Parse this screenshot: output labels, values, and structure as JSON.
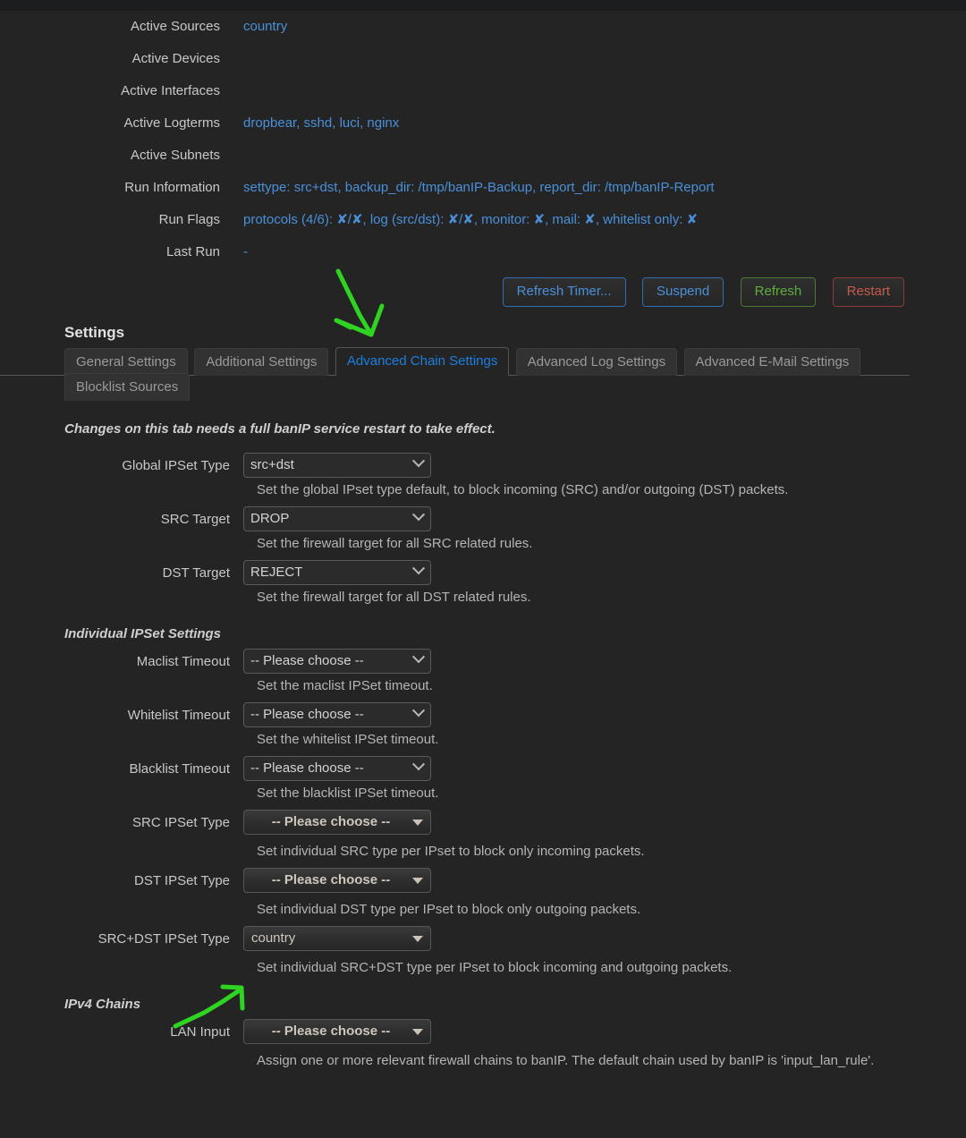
{
  "status": {
    "rows": [
      {
        "label": "Active Sources",
        "value": "country"
      },
      {
        "label": "Active Devices",
        "value": ""
      },
      {
        "label": "Active Interfaces",
        "value": ""
      },
      {
        "label": "Active Logterms",
        "value": "dropbear, sshd, luci, nginx"
      },
      {
        "label": "Active Subnets",
        "value": ""
      },
      {
        "label": "Run Information",
        "value": "settype: src+dst, backup_dir: /tmp/banIP-Backup, report_dir: /tmp/banIP-Report"
      },
      {
        "label": "Run Flags",
        "value": "protocols (4/6): ✘/✘, log (src/dst): ✘/✘, monitor: ✘, mail: ✘, whitelist only: ✘"
      },
      {
        "label": "Last Run",
        "value": "-"
      }
    ]
  },
  "actions": {
    "refresh_timer": "Refresh Timer...",
    "suspend": "Suspend",
    "refresh": "Refresh",
    "restart": "Restart"
  },
  "settings": {
    "heading": "Settings",
    "tabs_row1": [
      {
        "label": "General Settings",
        "active": false
      },
      {
        "label": "Additional Settings",
        "active": false
      },
      {
        "label": "Advanced Chain Settings",
        "active": true
      },
      {
        "label": "Advanced Log Settings",
        "active": false
      },
      {
        "label": "Advanced E-Mail Settings",
        "active": false
      }
    ],
    "tabs_row2": [
      {
        "label": "Blocklist Sources",
        "active": false
      }
    ],
    "restart_note": "Changes on this tab needs a full banIP service restart to take effect."
  },
  "fields": {
    "global_ipset_type": {
      "label": "Global IPSet Type",
      "value": "src+dst",
      "hint": "Set the global IPset type default, to block incoming (SRC) and/or outgoing (DST) packets."
    },
    "src_target": {
      "label": "SRC Target",
      "value": "DROP",
      "hint": "Set the firewall target for all SRC related rules."
    },
    "dst_target": {
      "label": "DST Target",
      "value": "REJECT",
      "hint": "Set the firewall target for all DST related rules."
    },
    "individual_group_title": "Individual IPSet Settings",
    "maclist_timeout": {
      "label": "Maclist Timeout",
      "value": "-- Please choose --",
      "hint": "Set the maclist IPSet timeout."
    },
    "whitelist_timeout": {
      "label": "Whitelist Timeout",
      "value": "-- Please choose --",
      "hint": "Set the whitelist IPSet timeout."
    },
    "blacklist_timeout": {
      "label": "Blacklist Timeout",
      "value": "-- Please choose --",
      "hint": "Set the blacklist IPSet timeout."
    },
    "src_ipset_type": {
      "label": "SRC IPSet Type",
      "value": "-- Please choose --",
      "hint": "Set individual SRC type per IPset to block only incoming packets."
    },
    "dst_ipset_type": {
      "label": "DST IPSet Type",
      "value": "-- Please choose --",
      "hint": "Set individual DST type per IPset to block only outgoing packets."
    },
    "srcdst_ipset_type": {
      "label": "SRC+DST IPSet Type",
      "value": "country",
      "hint": "Set individual SRC+DST type per IPset to block incoming and outgoing packets."
    },
    "ipv4_group_title": "IPv4 Chains",
    "lan_input": {
      "label": "LAN Input",
      "value": "-- Please choose --",
      "hint": "Assign one or more relevant firewall chains to banIP. The default chain used by banIP is 'input_lan_rule'."
    }
  },
  "annotations": {
    "accent_color": "#2fd321",
    "arrow_to_active_tab": "arrow pointing down at Advanced Chain Settings tab",
    "arrow_to_srcdst": "arrow pointing up-right at SRC+DST IPSet Type dropdown"
  }
}
